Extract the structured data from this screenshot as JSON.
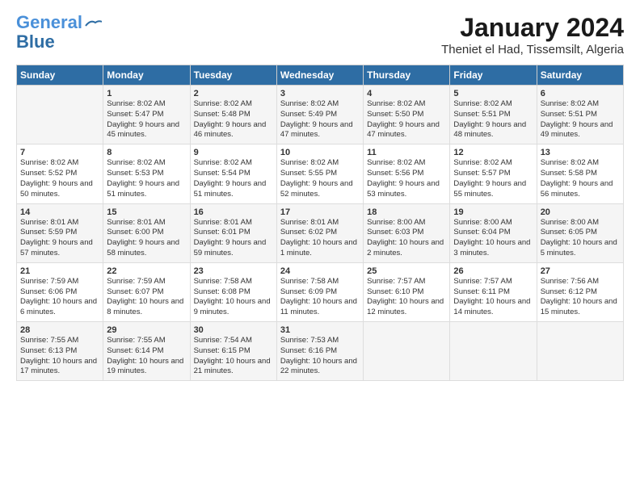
{
  "header": {
    "logo_line1": "General",
    "logo_line2": "Blue",
    "main_title": "January 2024",
    "subtitle": "Theniet el Had, Tissemsilt, Algeria"
  },
  "days_of_week": [
    "Sunday",
    "Monday",
    "Tuesday",
    "Wednesday",
    "Thursday",
    "Friday",
    "Saturday"
  ],
  "weeks": [
    [
      {
        "num": "",
        "sunrise": "",
        "sunset": "",
        "daylight": ""
      },
      {
        "num": "1",
        "sunrise": "Sunrise: 8:02 AM",
        "sunset": "Sunset: 5:47 PM",
        "daylight": "Daylight: 9 hours and 45 minutes."
      },
      {
        "num": "2",
        "sunrise": "Sunrise: 8:02 AM",
        "sunset": "Sunset: 5:48 PM",
        "daylight": "Daylight: 9 hours and 46 minutes."
      },
      {
        "num": "3",
        "sunrise": "Sunrise: 8:02 AM",
        "sunset": "Sunset: 5:49 PM",
        "daylight": "Daylight: 9 hours and 47 minutes."
      },
      {
        "num": "4",
        "sunrise": "Sunrise: 8:02 AM",
        "sunset": "Sunset: 5:50 PM",
        "daylight": "Daylight: 9 hours and 47 minutes."
      },
      {
        "num": "5",
        "sunrise": "Sunrise: 8:02 AM",
        "sunset": "Sunset: 5:51 PM",
        "daylight": "Daylight: 9 hours and 48 minutes."
      },
      {
        "num": "6",
        "sunrise": "Sunrise: 8:02 AM",
        "sunset": "Sunset: 5:51 PM",
        "daylight": "Daylight: 9 hours and 49 minutes."
      }
    ],
    [
      {
        "num": "7",
        "sunrise": "Sunrise: 8:02 AM",
        "sunset": "Sunset: 5:52 PM",
        "daylight": "Daylight: 9 hours and 50 minutes."
      },
      {
        "num": "8",
        "sunrise": "Sunrise: 8:02 AM",
        "sunset": "Sunset: 5:53 PM",
        "daylight": "Daylight: 9 hours and 51 minutes."
      },
      {
        "num": "9",
        "sunrise": "Sunrise: 8:02 AM",
        "sunset": "Sunset: 5:54 PM",
        "daylight": "Daylight: 9 hours and 51 minutes."
      },
      {
        "num": "10",
        "sunrise": "Sunrise: 8:02 AM",
        "sunset": "Sunset: 5:55 PM",
        "daylight": "Daylight: 9 hours and 52 minutes."
      },
      {
        "num": "11",
        "sunrise": "Sunrise: 8:02 AM",
        "sunset": "Sunset: 5:56 PM",
        "daylight": "Daylight: 9 hours and 53 minutes."
      },
      {
        "num": "12",
        "sunrise": "Sunrise: 8:02 AM",
        "sunset": "Sunset: 5:57 PM",
        "daylight": "Daylight: 9 hours and 55 minutes."
      },
      {
        "num": "13",
        "sunrise": "Sunrise: 8:02 AM",
        "sunset": "Sunset: 5:58 PM",
        "daylight": "Daylight: 9 hours and 56 minutes."
      }
    ],
    [
      {
        "num": "14",
        "sunrise": "Sunrise: 8:01 AM",
        "sunset": "Sunset: 5:59 PM",
        "daylight": "Daylight: 9 hours and 57 minutes."
      },
      {
        "num": "15",
        "sunrise": "Sunrise: 8:01 AM",
        "sunset": "Sunset: 6:00 PM",
        "daylight": "Daylight: 9 hours and 58 minutes."
      },
      {
        "num": "16",
        "sunrise": "Sunrise: 8:01 AM",
        "sunset": "Sunset: 6:01 PM",
        "daylight": "Daylight: 9 hours and 59 minutes."
      },
      {
        "num": "17",
        "sunrise": "Sunrise: 8:01 AM",
        "sunset": "Sunset: 6:02 PM",
        "daylight": "Daylight: 10 hours and 1 minute."
      },
      {
        "num": "18",
        "sunrise": "Sunrise: 8:00 AM",
        "sunset": "Sunset: 6:03 PM",
        "daylight": "Daylight: 10 hours and 2 minutes."
      },
      {
        "num": "19",
        "sunrise": "Sunrise: 8:00 AM",
        "sunset": "Sunset: 6:04 PM",
        "daylight": "Daylight: 10 hours and 3 minutes."
      },
      {
        "num": "20",
        "sunrise": "Sunrise: 8:00 AM",
        "sunset": "Sunset: 6:05 PM",
        "daylight": "Daylight: 10 hours and 5 minutes."
      }
    ],
    [
      {
        "num": "21",
        "sunrise": "Sunrise: 7:59 AM",
        "sunset": "Sunset: 6:06 PM",
        "daylight": "Daylight: 10 hours and 6 minutes."
      },
      {
        "num": "22",
        "sunrise": "Sunrise: 7:59 AM",
        "sunset": "Sunset: 6:07 PM",
        "daylight": "Daylight: 10 hours and 8 minutes."
      },
      {
        "num": "23",
        "sunrise": "Sunrise: 7:58 AM",
        "sunset": "Sunset: 6:08 PM",
        "daylight": "Daylight: 10 hours and 9 minutes."
      },
      {
        "num": "24",
        "sunrise": "Sunrise: 7:58 AM",
        "sunset": "Sunset: 6:09 PM",
        "daylight": "Daylight: 10 hours and 11 minutes."
      },
      {
        "num": "25",
        "sunrise": "Sunrise: 7:57 AM",
        "sunset": "Sunset: 6:10 PM",
        "daylight": "Daylight: 10 hours and 12 minutes."
      },
      {
        "num": "26",
        "sunrise": "Sunrise: 7:57 AM",
        "sunset": "Sunset: 6:11 PM",
        "daylight": "Daylight: 10 hours and 14 minutes."
      },
      {
        "num": "27",
        "sunrise": "Sunrise: 7:56 AM",
        "sunset": "Sunset: 6:12 PM",
        "daylight": "Daylight: 10 hours and 15 minutes."
      }
    ],
    [
      {
        "num": "28",
        "sunrise": "Sunrise: 7:55 AM",
        "sunset": "Sunset: 6:13 PM",
        "daylight": "Daylight: 10 hours and 17 minutes."
      },
      {
        "num": "29",
        "sunrise": "Sunrise: 7:55 AM",
        "sunset": "Sunset: 6:14 PM",
        "daylight": "Daylight: 10 hours and 19 minutes."
      },
      {
        "num": "30",
        "sunrise": "Sunrise: 7:54 AM",
        "sunset": "Sunset: 6:15 PM",
        "daylight": "Daylight: 10 hours and 21 minutes."
      },
      {
        "num": "31",
        "sunrise": "Sunrise: 7:53 AM",
        "sunset": "Sunset: 6:16 PM",
        "daylight": "Daylight: 10 hours and 22 minutes."
      },
      {
        "num": "",
        "sunrise": "",
        "sunset": "",
        "daylight": ""
      },
      {
        "num": "",
        "sunrise": "",
        "sunset": "",
        "daylight": ""
      },
      {
        "num": "",
        "sunrise": "",
        "sunset": "",
        "daylight": ""
      }
    ]
  ]
}
